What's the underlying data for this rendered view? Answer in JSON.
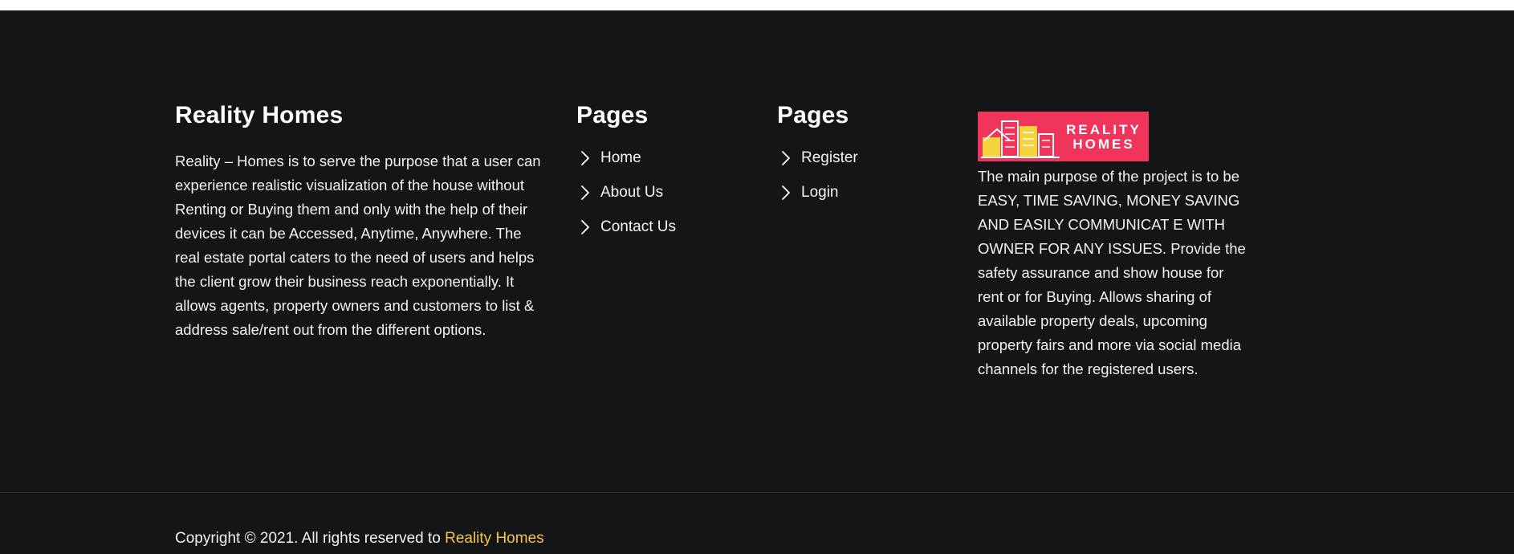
{
  "about": {
    "title": "Reality Homes",
    "text": "Reality – Homes is to serve the purpose that a user can experience realistic visualization of the house without Renting or Buying them and only with the help of their devices it can be Accessed, Anytime, Anywhere. The real estate portal caters to the need of users and helps the client grow their business reach exponentially. It allows agents, property owners and customers to list & address sale/rent out from the different options."
  },
  "pages_primary": {
    "title": "Pages",
    "links": [
      {
        "label": "Home",
        "icon": "chevron-right-icon"
      },
      {
        "label": "About Us",
        "icon": "chevron-right-icon"
      },
      {
        "label": "Contact Us",
        "icon": "chevron-right-icon"
      }
    ]
  },
  "pages_secondary": {
    "title": "Pages",
    "links": [
      {
        "label": "Register",
        "icon": "chevron-right-icon"
      },
      {
        "label": "Login",
        "icon": "chevron-right-icon"
      }
    ]
  },
  "brand": {
    "logo_line1": "REALITY",
    "logo_line2": "HOMES",
    "logo_color": "#f0345a",
    "text": "The main purpose of the project is to be EASY, TIME SAVING, MONEY SAVING AND EASILY COMMUNICAT E WITH OWNER FOR ANY ISSUES. Provide the safety assurance and show house for rent or for Buying. Allows sharing of available property deals, upcoming property fairs and more via social media channels for the registered users."
  },
  "copyright": {
    "prefix": "Copyright © 2021. All rights reserved to ",
    "brand": "Reality Homes",
    "brand_color": "#f7c548"
  },
  "colors": {
    "footer_bg": "#141517",
    "text": "#ffffff"
  }
}
